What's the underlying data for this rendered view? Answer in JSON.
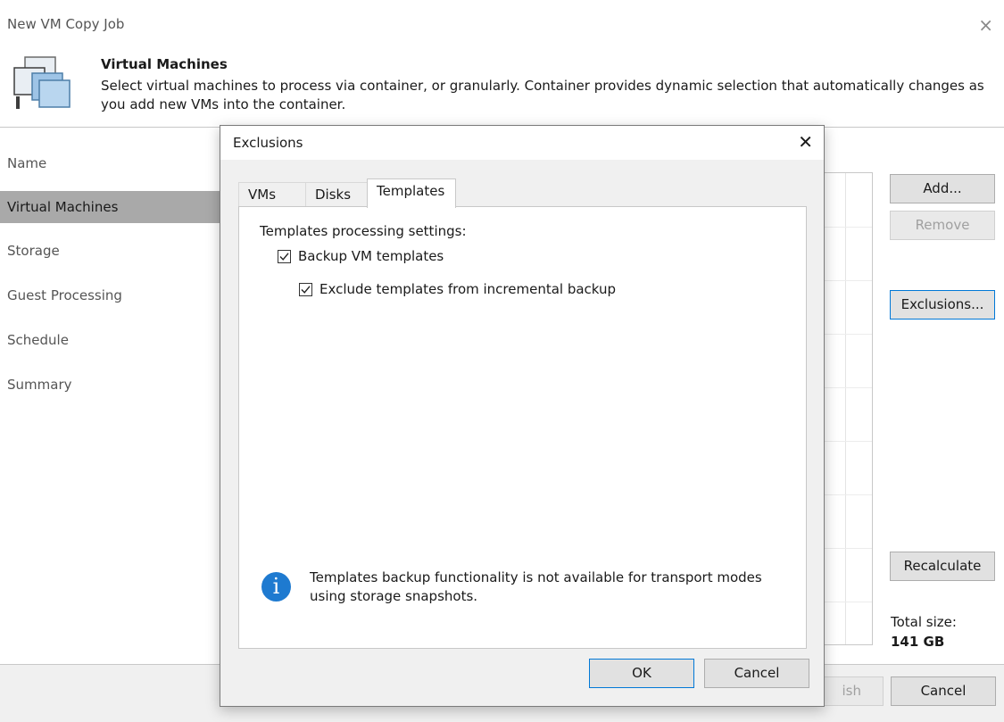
{
  "window": {
    "title": "New VM Copy Job",
    "close_glyph": "×"
  },
  "header": {
    "title": "Virtual Machines",
    "description": "Select virtual machines to process via container, or granularly. Container provides dynamic selection that automatically changes as you add new VMs into the container.",
    "icon": "virtual-machines-icon"
  },
  "steps": [
    {
      "label": "Name",
      "active": false
    },
    {
      "label": "Virtual Machines",
      "active": true
    },
    {
      "label": "Storage",
      "active": false
    },
    {
      "label": "Guest Processing",
      "active": false
    },
    {
      "label": "Schedule",
      "active": false
    },
    {
      "label": "Summary",
      "active": false
    }
  ],
  "side_buttons": {
    "add": "Add...",
    "remove": "Remove",
    "exclusions": "Exclusions...",
    "recalculate": "Recalculate"
  },
  "total": {
    "label": "Total size:",
    "value": "141 GB"
  },
  "footer": {
    "finish_partial": "ish",
    "cancel": "Cancel"
  },
  "dialog": {
    "title": "Exclusions",
    "close_glyph": "✕",
    "tabs": [
      {
        "label": "VMs",
        "active": false
      },
      {
        "label": "Disks",
        "active": false
      },
      {
        "label": "Templates",
        "active": true
      }
    ],
    "settings_heading": "Templates processing settings:",
    "checkboxes": [
      {
        "label": "Backup VM templates",
        "checked": true
      },
      {
        "label": "Exclude templates from incremental backup",
        "checked": true
      }
    ],
    "info_icon_glyph": "i",
    "info_text": "Templates backup functionality is not available for transport modes using storage snapshots.",
    "ok": "OK",
    "cancel": "Cancel"
  },
  "colors": {
    "active_step": "#a9a9a9",
    "info_blue": "#1e7ad0",
    "focus_border": "#0078d7"
  }
}
